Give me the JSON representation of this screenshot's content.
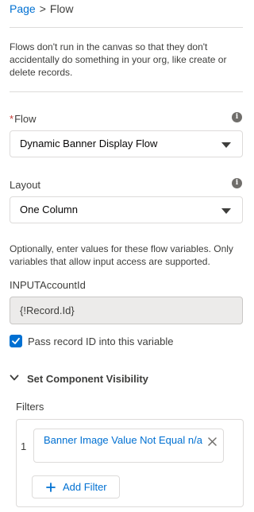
{
  "breadcrumb": {
    "parent": "Page",
    "separator": ">",
    "current": "Flow"
  },
  "info_text": "Flows don't run in the canvas so that they don't accidentally do something in your org, like create or delete records.",
  "flow_field": {
    "required_marker": "*",
    "label": "Flow",
    "value": "Dynamic Banner Display Flow"
  },
  "layout_field": {
    "label": "Layout",
    "value": "One Column"
  },
  "variables_help": "Optionally, enter values for these flow variables. Only variables that allow input access are supported.",
  "input_account": {
    "label": "INPUTAccountId",
    "value": "{!Record.Id}"
  },
  "pass_record_checkbox": {
    "checked": true,
    "label": "Pass record ID into this variable"
  },
  "visibility_section": {
    "title": "Set Component Visibility",
    "expanded": true,
    "filters_label": "Filters",
    "filters": [
      {
        "index": "1",
        "text": "Banner Image Value Not Equal n/a"
      }
    ],
    "add_filter_label": "Add Filter"
  },
  "icons": {
    "info": "info-icon",
    "caret": "chevron-down-icon",
    "check": "check-icon",
    "remove": "close-icon",
    "add": "plus-icon"
  },
  "colors": {
    "link": "#0070d2",
    "text": "#3e3e3c",
    "border": "#dddbda",
    "required": "#c23934",
    "disabled_bg": "#ecebea"
  }
}
